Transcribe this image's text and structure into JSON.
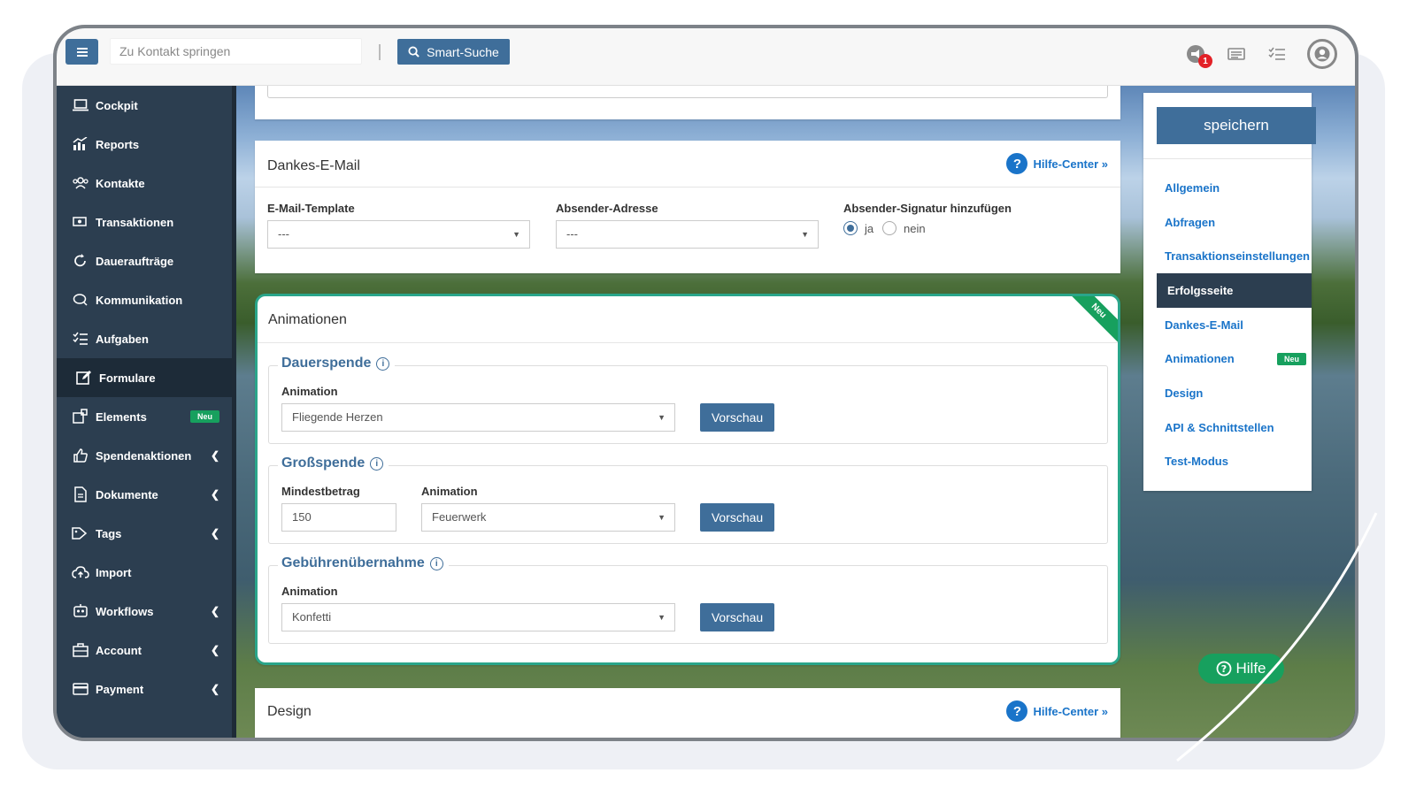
{
  "topbar": {
    "search_placeholder": "Zu Kontakt springen",
    "smart_search_label": "Smart-Suche",
    "notification_count": "1"
  },
  "sidebar": {
    "items": [
      {
        "label": "Cockpit",
        "icon": "laptop-icon"
      },
      {
        "label": "Reports",
        "icon": "chart-icon"
      },
      {
        "label": "Kontakte",
        "icon": "users-icon"
      },
      {
        "label": "Transaktionen",
        "icon": "money-icon"
      },
      {
        "label": "Daueraufträge",
        "icon": "recurring-icon"
      },
      {
        "label": "Kommunikation",
        "icon": "chat-icon"
      },
      {
        "label": "Aufgaben",
        "icon": "tasks-icon"
      },
      {
        "label": "Formulare",
        "icon": "edit-icon"
      },
      {
        "label": "Elements",
        "icon": "elements-icon",
        "badge": "Neu"
      },
      {
        "label": "Spendenaktionen",
        "icon": "thumbs-up-icon"
      },
      {
        "label": "Dokumente",
        "icon": "document-icon"
      },
      {
        "label": "Tags",
        "icon": "tag-icon"
      },
      {
        "label": "Import",
        "icon": "upload-icon"
      },
      {
        "label": "Workflows",
        "icon": "workflow-icon"
      },
      {
        "label": "Account",
        "icon": "briefcase-icon"
      },
      {
        "label": "Payment",
        "icon": "card-icon"
      }
    ]
  },
  "dankes": {
    "title": "Dankes-E-Mail",
    "help_label": "Hilfe-Center »",
    "template_label": "E-Mail-Template",
    "template_value": "---",
    "sender_label": "Absender-Adresse",
    "sender_value": "---",
    "signature_label": "Absender-Signatur hinzufügen",
    "yes_label": "ja",
    "no_label": "nein"
  },
  "animationen": {
    "title": "Animationen",
    "ribbon": "Neu",
    "dauerspende": {
      "legend": "Dauerspende",
      "animation_label": "Animation",
      "animation_value": "Fliegende Herzen",
      "preview_label": "Vorschau"
    },
    "grossspende": {
      "legend": "Großspende",
      "min_label": "Mindestbetrag",
      "min_value": "150",
      "animation_label": "Animation",
      "animation_value": "Feuerwerk",
      "preview_label": "Vorschau"
    },
    "gebuehren": {
      "legend": "Gebührenübernahme",
      "animation_label": "Animation",
      "animation_value": "Konfetti",
      "preview_label": "Vorschau"
    }
  },
  "design": {
    "title": "Design",
    "help_label": "Hilfe-Center »"
  },
  "rightpanel": {
    "save_label": "speichern",
    "items": [
      {
        "label": "Allgemein"
      },
      {
        "label": "Abfragen"
      },
      {
        "label": "Transaktionseinstellungen"
      },
      {
        "label": "Erfolgsseite"
      },
      {
        "label": "Dankes-E-Mail"
      },
      {
        "label": "Animationen",
        "badge": "Neu"
      },
      {
        "label": "Design"
      },
      {
        "label": "API & Schnittstellen"
      },
      {
        "label": "Test-Modus"
      }
    ]
  },
  "help_button_label": "Hilfe",
  "colors": {
    "primary": "#3f6e9a",
    "sidebar": "#2c3e50",
    "link": "#1a74c9",
    "new_badge": "#17a05e",
    "highlight_border": "#2aa58a"
  }
}
